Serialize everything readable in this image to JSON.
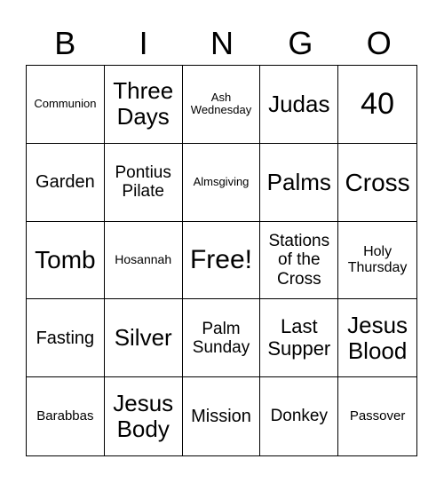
{
  "header": [
    "B",
    "I",
    "N",
    "G",
    "O"
  ],
  "cells": [
    "Communion",
    "Three Days",
    "Ash Wednesday",
    "Judas",
    "40",
    "Garden",
    "Pontius Pilate",
    "Almsgiving",
    "Palms",
    "Cross",
    "Tomb",
    "Hosannah",
    "Free!",
    "Stations of the Cross",
    "Holy Thursday",
    "Fasting",
    "Silver",
    "Palm Sunday",
    "Last Supper",
    "Jesus Blood",
    "Barabbas",
    "Jesus Body",
    "Mission",
    "Donkey",
    "Passover"
  ]
}
